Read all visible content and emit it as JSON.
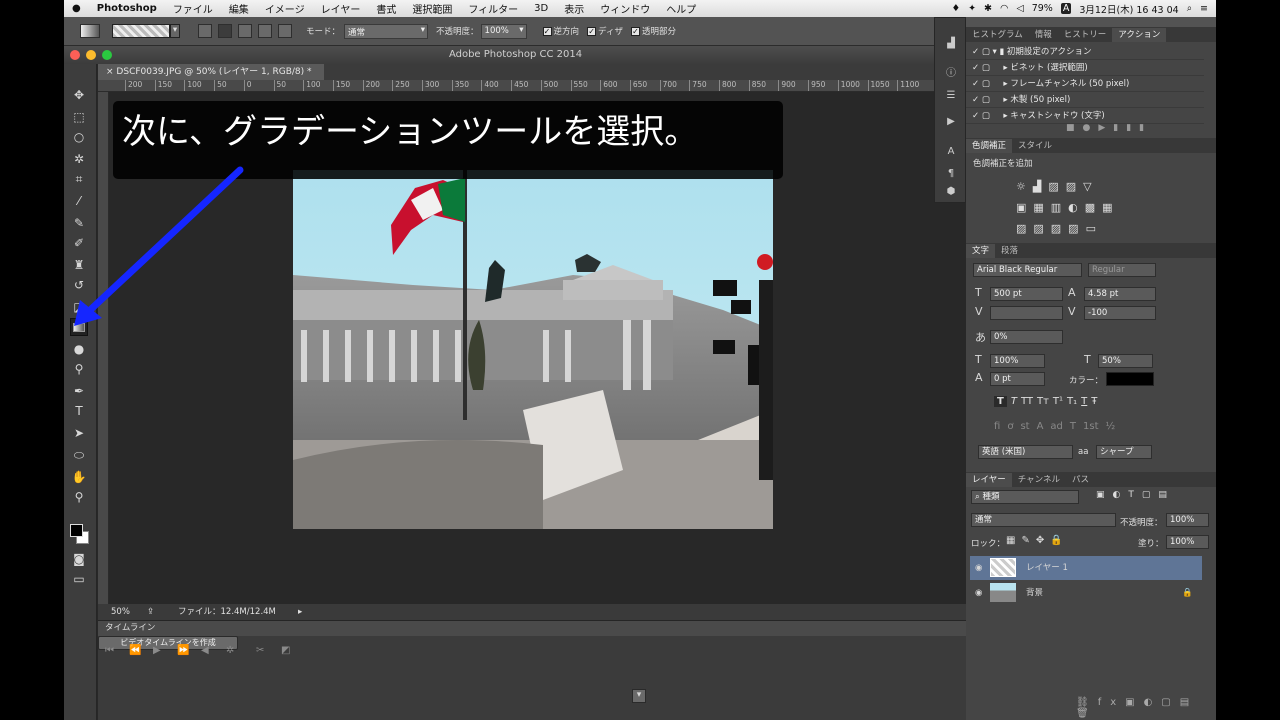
{
  "menubar": {
    "app": "Photoshop",
    "items": [
      "ファイル",
      "編集",
      "イメージ",
      "レイヤー",
      "書式",
      "選択範囲",
      "フィルター",
      "3D",
      "表示",
      "ウィンドウ",
      "ヘルプ"
    ],
    "battery": "79%",
    "input_mode": "A",
    "clock": "3月12日(木)  16 43 04"
  },
  "options": {
    "mode_label": "モード：",
    "mode_value": "通常",
    "opacity_label": "不透明度：",
    "opacity_value": "100%",
    "reverse": "逆方向",
    "dither": "ディザ",
    "transparency": "透明部分"
  },
  "window": {
    "title": "Adobe Photoshop CC 2014"
  },
  "document": {
    "tab": "DSCF0039.JPG @ 50% (レイヤー 1, RGB/8) *"
  },
  "ruler": {
    "ticks": [
      "200",
      "150",
      "100",
      "50",
      "0",
      "50",
      "100",
      "150",
      "200",
      "250",
      "300",
      "350",
      "400",
      "450",
      "500",
      "550",
      "600",
      "650",
      "700",
      "750",
      "800",
      "850",
      "900",
      "950",
      "1000",
      "1050",
      "1100"
    ]
  },
  "banner": {
    "text": "次に、グラデーションツールを選択。"
  },
  "status": {
    "zoom": "50%",
    "file": "ファイル：12.4M/12.4M"
  },
  "timeline": {
    "title": "タイムライン",
    "create_button": "ビデオタイムラインを作成"
  },
  "actions_panel": {
    "tabs": [
      "ヒストグラム",
      "情報",
      "ヒストリー",
      "アクション"
    ],
    "items": [
      "初期設定のアクション",
      "ビネット (選択範囲)",
      "フレームチャンネル (50 pixel)",
      "木製 (50 pixel)",
      "キャストシャドウ (文字)"
    ]
  },
  "adjust_panel": {
    "tabs": [
      "色調補正",
      "スタイル"
    ],
    "heading": "色調補正を追加"
  },
  "type_panel": {
    "tabs": [
      "文字",
      "段落"
    ],
    "font": "Arial Black Regular",
    "style": "Regular",
    "size": "500 pt",
    "leading": "4.58 pt",
    "tracking": "-100",
    "scale": "0%",
    "vscale": "100%",
    "hscale": "50%",
    "baseline": "0 pt",
    "color_label": "カラー：",
    "language": "英語 (米国)",
    "aa_label": "aa",
    "antialias": "シャープ",
    "fmt_glyphs": [
      "T",
      "T",
      "TT",
      "Tт",
      "T¹",
      "T₁",
      "T",
      "Ŧ"
    ],
    "ot_glyphs": [
      "fi",
      "ơ",
      "st",
      "A",
      "ad",
      "T",
      "1st",
      "½"
    ]
  },
  "layers_panel": {
    "tabs": [
      "レイヤー",
      "チャンネル",
      "パス"
    ],
    "filter": "種類",
    "blend": "通常",
    "opacity_label": "不透明度：",
    "opacity": "100%",
    "lock_label": "ロック：",
    "fill_label": "塗り：",
    "fill": "100%",
    "layers": [
      "レイヤー 1",
      "背景"
    ]
  },
  "colors": {
    "accent": "#1526ff",
    "selected_layer": "#5f7596",
    "panel": "#454545"
  }
}
